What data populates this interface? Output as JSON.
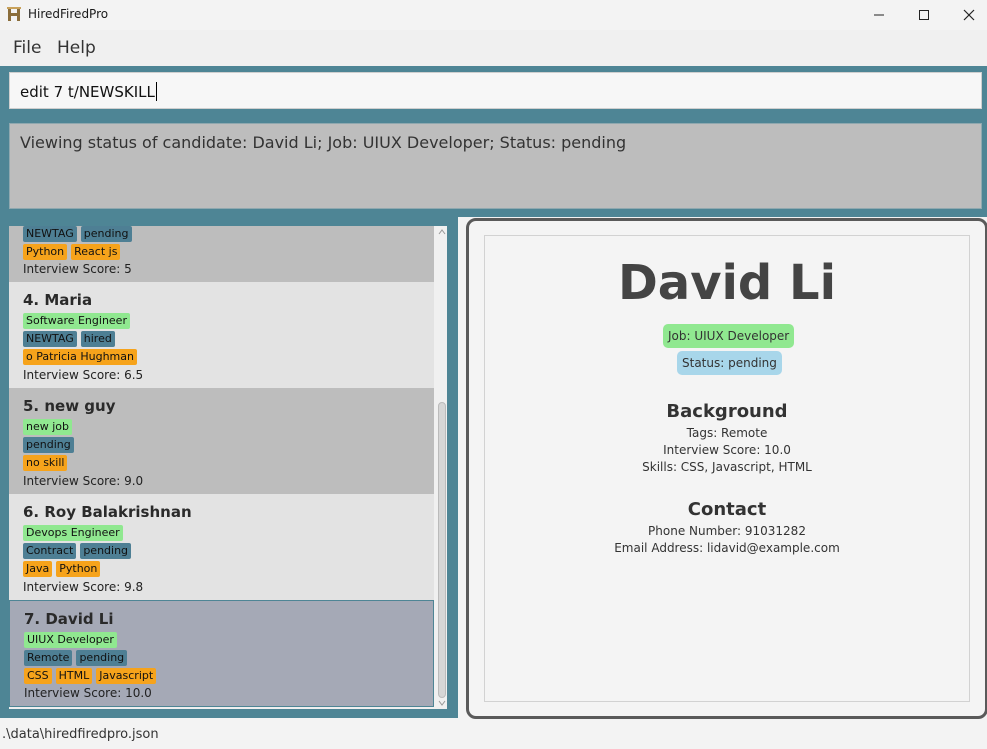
{
  "window": {
    "title": "HiredFiredPro"
  },
  "menu": {
    "file": "File",
    "help": "Help"
  },
  "command": {
    "value": "edit 7 t/NEWSKILL"
  },
  "result": {
    "text": "Viewing status of candidate: David Li; Job: UIUX Developer; Status: pending"
  },
  "list": {
    "cards": [
      {
        "name": "",
        "job": "",
        "misc": [
          "NEWTAG",
          "pending"
        ],
        "skills": [
          "Python",
          "React js"
        ],
        "score": "Interview Score: 5"
      },
      {
        "name": "4.  Maria",
        "job": "Software Engineer",
        "misc": [
          "NEWTAG",
          "hired"
        ],
        "skills": [
          "o Patricia Hughman"
        ],
        "score": "Interview Score: 6.5"
      },
      {
        "name": "5.  new guy",
        "job": "new job",
        "misc": [
          "pending"
        ],
        "skills": [
          "no skill"
        ],
        "score": "Interview Score: 9.0"
      },
      {
        "name": "6.  Roy Balakrishnan",
        "job": "Devops Engineer",
        "misc": [
          "Contract",
          "pending"
        ],
        "skills": [
          "Java",
          "Python"
        ],
        "score": "Interview Score: 9.8"
      },
      {
        "name": "7.  David Li",
        "job": "UIUX Developer",
        "misc": [
          "Remote",
          "pending"
        ],
        "skills": [
          "CSS",
          "HTML",
          "Javascript"
        ],
        "score": "Interview Score: 10.0"
      }
    ]
  },
  "detail": {
    "name": "David Li",
    "job": "Job: UIUX Developer",
    "status": "Status: pending",
    "background_title": "Background",
    "tags": "Tags: Remote",
    "interview_score": "Interview Score: 10.0",
    "skills": "Skills: CSS, Javascript, HTML",
    "contact_title": "Contact",
    "phone": "Phone Number: 91031282",
    "email": "Email Address: lidavid@example.com"
  },
  "statusbar": {
    "path": ".\\data\\hiredfiredpro.json"
  },
  "colors": {
    "accent": "#4e8595",
    "job_tag": "#90e890",
    "misc_tag": "#4e7f94",
    "skill_tag": "#f6a31b",
    "status_pill": "#a8d6ea",
    "selected_card": "#a5a9b6"
  }
}
